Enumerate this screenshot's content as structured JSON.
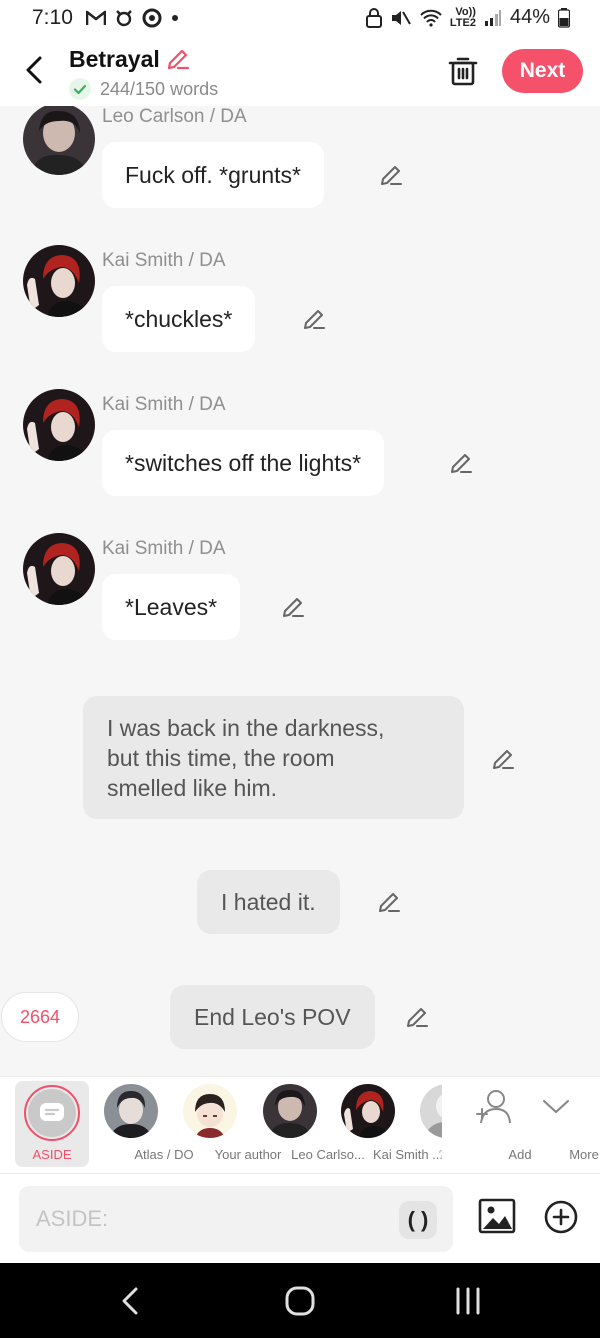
{
  "status_bar": {
    "time": "7:10",
    "network_top": "Vo))",
    "network_bottom": "LTE2",
    "battery": "44%"
  },
  "header": {
    "title": "Betrayal",
    "word_count": "244/150 words",
    "next_label": "Next"
  },
  "messages": [
    {
      "type": "character",
      "sender": "Leo Carlson / DA",
      "text": "Fuck off. *grunts*",
      "avatar": "leo"
    },
    {
      "type": "character",
      "sender": "Kai Smith / DA",
      "text": "*chuckles*",
      "avatar": "kai"
    },
    {
      "type": "character",
      "sender": "Kai Smith / DA",
      "text": "*switches off the lights*",
      "avatar": "kai"
    },
    {
      "type": "character",
      "sender": "Kai Smith / DA",
      "text": "*Leaves*",
      "avatar": "kai"
    },
    {
      "type": "narration",
      "lines": [
        "I was back in the darkness,",
        "but this time, the room",
        "smelled like him."
      ]
    },
    {
      "type": "narration",
      "text": "I hated it."
    },
    {
      "type": "narration",
      "text": "End Leo's POV"
    }
  ],
  "counter": "2664",
  "characters": [
    {
      "label": "ASIDE",
      "selected": true
    },
    {
      "label": "Atlas / DO"
    },
    {
      "label": "Your author"
    },
    {
      "label": "Leo Carlso..."
    },
    {
      "label": "Kai Smith ..."
    },
    {
      "label": "?"
    }
  ],
  "actions": {
    "add_label": "Add",
    "more_label": "More"
  },
  "input": {
    "placeholder": "ASIDE:",
    "paren_label": "( )"
  },
  "colors": {
    "accent": "#f6516b",
    "bubble": "#ffffff",
    "narration_bubble": "#e9e9e9",
    "background": "#f6f6f6"
  }
}
